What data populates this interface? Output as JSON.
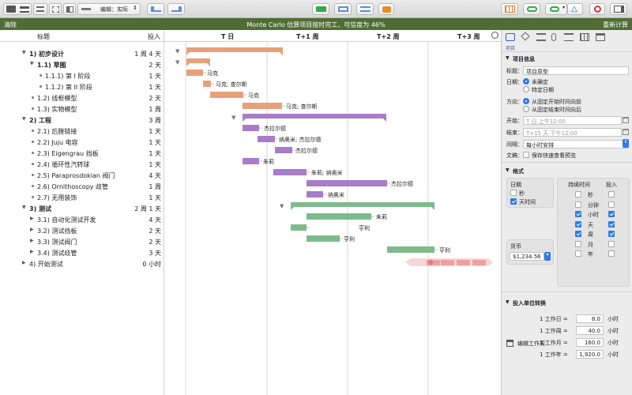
{
  "toolbar": {
    "baseline_select": "编辑：实际"
  },
  "banner": {
    "left": "清除",
    "center": "Monte Carlo 估算项目按时完工，可信度为 46%",
    "right": "重新计算"
  },
  "outline": {
    "col_title": "标题",
    "col_effort": "投入",
    "rows": [
      {
        "num": "1)",
        "title": "初步设计",
        "effort": "1 周 4 天",
        "bold": true
      },
      {
        "num": "1.1)",
        "title": "草图",
        "effort": "2 天",
        "bold": true
      },
      {
        "num": "1.1.1)",
        "title": "第 I 阶段",
        "effort": "1 天"
      },
      {
        "num": "1.1.2)",
        "title": "第 II 阶段",
        "effort": "1 天"
      },
      {
        "num": "1.2)",
        "title": "线框模型",
        "effort": "2 天"
      },
      {
        "num": "1.3)",
        "title": "实物模型",
        "effort": "1 周"
      },
      {
        "num": "2)",
        "title": "工程",
        "effort": "3 周",
        "bold": true
      },
      {
        "num": "2.1)",
        "title": "后膛链接",
        "effort": "1 天"
      },
      {
        "num": "2.2)",
        "title": "Juju 电容",
        "effort": "1 天"
      },
      {
        "num": "2.3)",
        "title": "Eigengrau 挡板",
        "effort": "1 天"
      },
      {
        "num": "2.4)",
        "title": "循环性汽转球",
        "effort": "1 天"
      },
      {
        "num": "2.5)",
        "title": "Paraprosdokian 阀门",
        "effort": "4 天"
      },
      {
        "num": "2.6)",
        "title": "Ornithoscopy 歧管",
        "effort": "1 周"
      },
      {
        "num": "2.7)",
        "title": "无用装饰",
        "effort": "1 天"
      },
      {
        "num": "3)",
        "title": "测试",
        "effort": "2 周 1 天",
        "bold": true
      },
      {
        "num": "3.1)",
        "title": "自动化测试开发",
        "effort": "4 天"
      },
      {
        "num": "3.2)",
        "title": "测试挡板",
        "effort": "2 天"
      },
      {
        "num": "3.3)",
        "title": "测试阀门",
        "effort": "2 天"
      },
      {
        "num": "3.4)",
        "title": "测试歧管",
        "effort": "3 天"
      },
      {
        "num": "4)",
        "title": "开始测试",
        "effort": "0 小时"
      }
    ]
  },
  "gantt": {
    "headers": [
      "T 日",
      "T+1 周",
      "T+2 周",
      "T+3 周"
    ],
    "labels": [
      "马克",
      "马克; 查尔斯",
      "马克",
      "马克; 查尔斯",
      "杰拉尔德",
      "纳奥米; 杰拉尔德",
      "杰拉尔德",
      "朱莉",
      "朱莉; 纳奥米",
      "杰拉尔德",
      "纳奥米",
      "朱莉",
      "亨利",
      "亨利",
      "亨利"
    ],
    "colors": {
      "design": "#e8a07a",
      "engineering": "#a97bc9",
      "testing": "#7dbb8c",
      "milestone": "#e57a7a"
    }
  },
  "inspector": {
    "tab_caption": "项目",
    "project_info": {
      "heading": "项目信息",
      "title_label": "标题：",
      "title_value": "项目原型",
      "date_label": "日期：",
      "date_opt1": "未确定",
      "date_opt2": "特定日期",
      "direction_label": "方向：",
      "direction_opt1": "从固定开始时间向前",
      "direction_opt2": "从固定结束时间向后",
      "start_label": "开始：",
      "start_placeholder": "T 日 上午12:00",
      "end_label": "结束：",
      "end_placeholder": "T+15 天 下午12:00",
      "interval_label": "间隔：",
      "interval_value": "每小时安排",
      "doc_label": "文稿：",
      "doc_option": "保存快速查看预览"
    },
    "format": {
      "heading": "格式",
      "date_label": "日期",
      "date_cb1": "秒",
      "date_cb2": "天时间",
      "duration_label": "持续时间",
      "effort_label": "投入",
      "units": [
        "秒",
        "分钟",
        "小时",
        "天",
        "周",
        "月",
        "年"
      ],
      "currency_label": "货币",
      "currency_value": "$1,234.56"
    },
    "conversion": {
      "heading": "投入单位转换",
      "rows": [
        {
          "label": "1 工作日 =",
          "value": "8.0",
          "unit": "小时"
        },
        {
          "label": "1 工作周 =",
          "value": "40.0",
          "unit": "小时"
        },
        {
          "label": "1 工作月 =",
          "value": "160.0",
          "unit": "小时"
        },
        {
          "label": "1 工作年 =",
          "value": "1,920.0",
          "unit": "小时"
        }
      ],
      "edit_week": "编辑工作周"
    }
  }
}
